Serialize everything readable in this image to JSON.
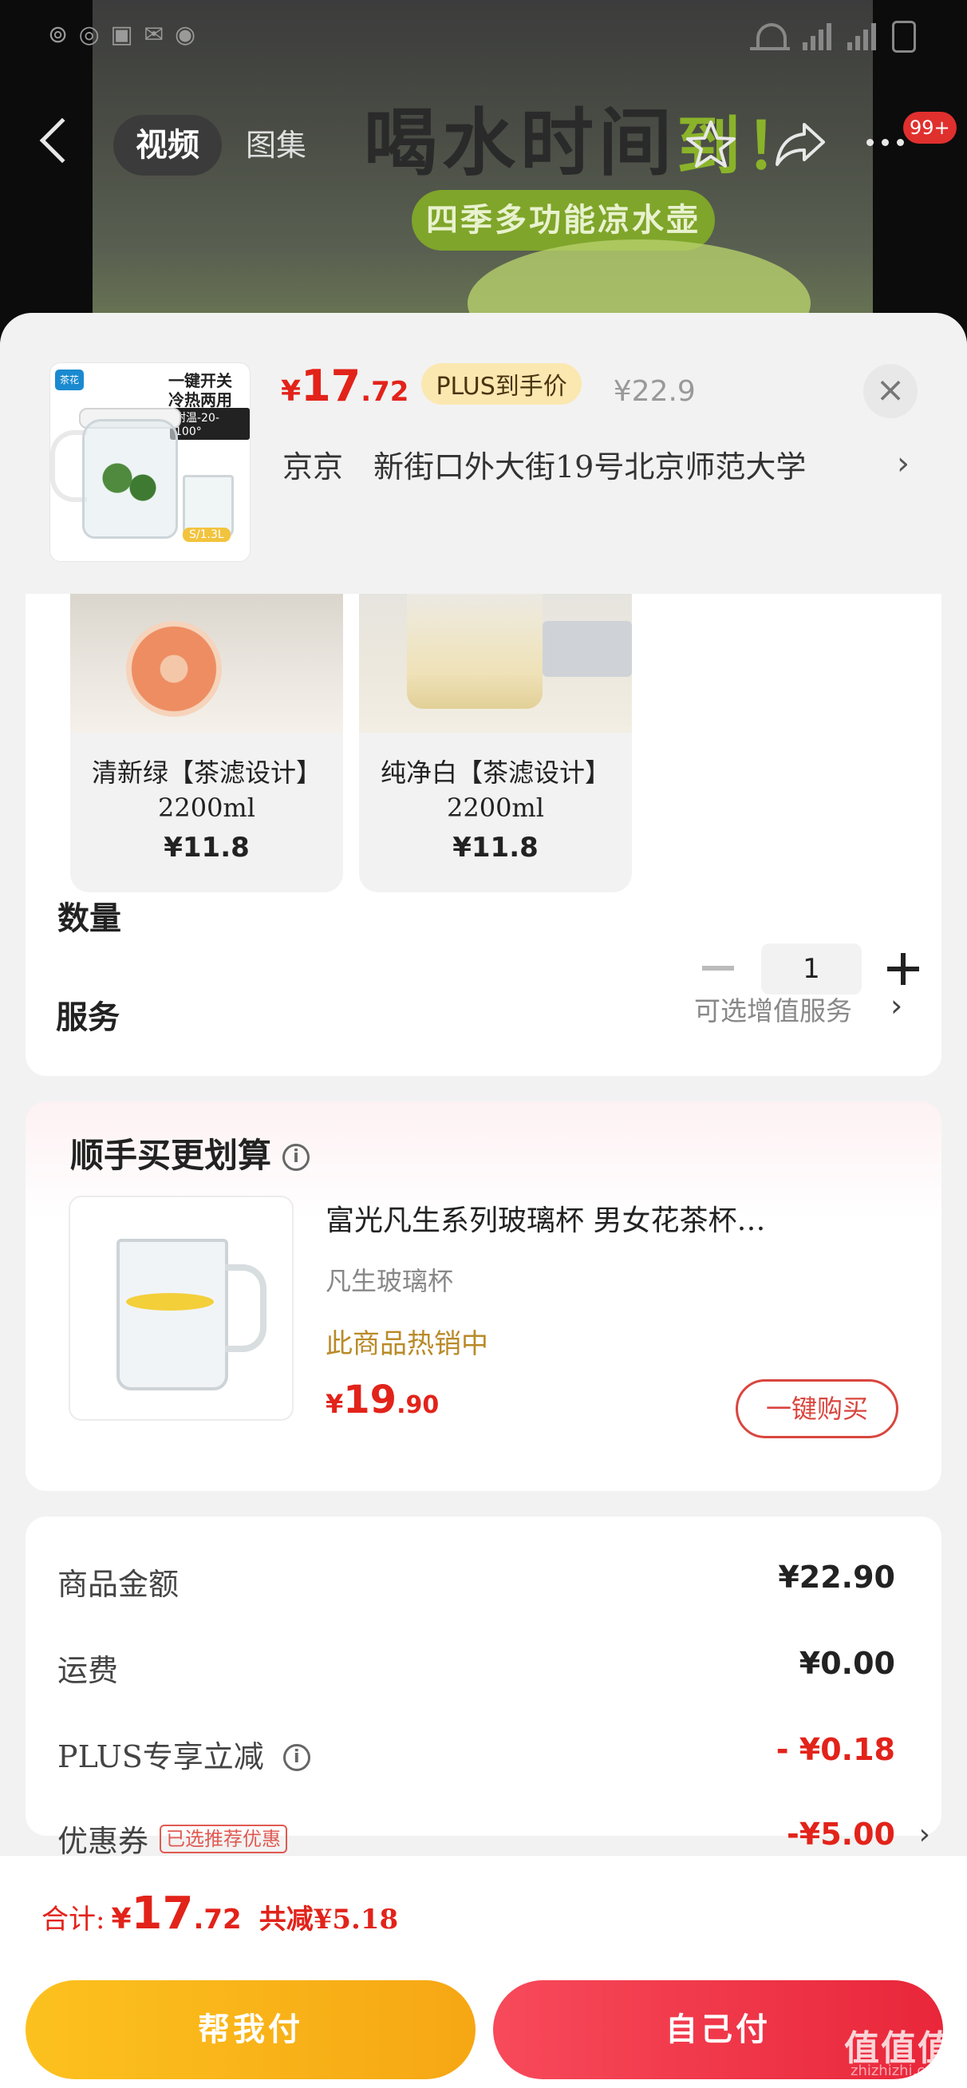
{
  "video": {
    "headline_main": "喝水时间",
    "headline_accent": "到！",
    "subtitle": "四季多功能凉水壶"
  },
  "nav": {
    "tabs": [
      {
        "label": "视频",
        "active": true
      },
      {
        "label": "图集",
        "active": false
      }
    ],
    "badge": "99+",
    "icons": [
      "back-arrow-icon",
      "star-icon",
      "share-icon",
      "more-icon"
    ]
  },
  "product": {
    "thumb": {
      "brand": "茶花",
      "line1": "一键开关",
      "line2": "冷热两用",
      "temp": "耐温-20-100°",
      "size": "S/1.3L"
    },
    "price": {
      "currency": "¥",
      "int": "17",
      "dec": ".72"
    },
    "plus_tag": "PLUS到手价",
    "original_price": "¥22.9",
    "address": "京京　新街口外大街19号北京师范大学",
    "address_chevron": "›",
    "close": "×"
  },
  "options": [
    {
      "name": "清新绿【茶滤设计】 2200ml",
      "price": "¥11.8"
    },
    {
      "name": "纯净白【茶滤设计】 2200ml",
      "price": "¥11.8"
    }
  ],
  "quantity": {
    "label": "数量",
    "value": "1"
  },
  "service": {
    "label": "服务",
    "value": "可选增值服务",
    "chevron": "›"
  },
  "bundle": {
    "title": "顺手买更划算",
    "info": "i",
    "item": {
      "name": "富光凡生系列玻璃杯 男女花茶杯…",
      "sub": "凡生玻璃杯",
      "status": "此商品热销中",
      "price": {
        "currency": "¥",
        "int": "19",
        "dec": ".90"
      },
      "button": "一键购买"
    }
  },
  "summary": {
    "rows": [
      {
        "label": "商品金额",
        "value": "¥22.90"
      },
      {
        "label": "运费",
        "value": "¥0.00"
      },
      {
        "label": "PLUS专享立减",
        "value": "- ¥0.18",
        "info": "i"
      },
      {
        "label": "优惠券",
        "tag": "已选推荐优惠",
        "value": "-¥5.00",
        "chevron": "›"
      }
    ]
  },
  "footer": {
    "total_label": "合计:",
    "total": {
      "currency": "¥",
      "int": "17",
      "dec": ".72"
    },
    "discount": "共减¥5.18",
    "help_pay": "帮我付",
    "self_pay": "自己付"
  },
  "watermark": {
    "main": "值值值",
    "sub": "zhizhizhi.com"
  },
  "colors": {
    "accent_red": "#e2231a",
    "plus_gold": "#fbe8b0",
    "help_btn": "#fcc11e",
    "self_btn": "#e9263a"
  }
}
